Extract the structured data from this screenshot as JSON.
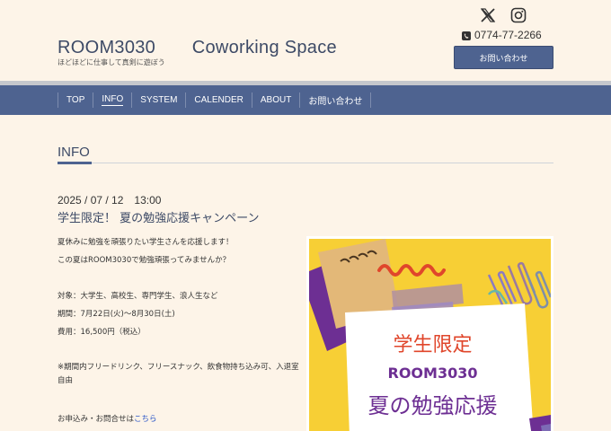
{
  "header": {
    "site_title": "ROOM3030　　Coworking Space",
    "tagline": "ほどほどに仕事して真剣に遊ぼう",
    "phone": "0774-77-2266",
    "contact_button": "お問い合わせ",
    "social_icons": [
      "x-icon",
      "instagram-icon"
    ]
  },
  "nav": {
    "items": [
      {
        "label": "TOP"
      },
      {
        "label": "INFO"
      },
      {
        "label": "SYSTEM"
      },
      {
        "label": "CALENDER"
      },
      {
        "label": "ABOUT"
      },
      {
        "label": "お問い合わせ"
      }
    ],
    "active": "INFO"
  },
  "section": {
    "title": "INFO"
  },
  "post": {
    "date": "2025 / 07 / 12　13:00",
    "title": "学生限定！ 夏の勉強応援キャンペーン",
    "lines": [
      "夏休みに勉強を頑張りたい学生さんを応援します！",
      "この夏はROOM3030で勉強頑張ってみませんか？",
      "対象：大学生、高校生、専門学生、浪人生など",
      "期間：7月22日(火)〜8月30日(土)",
      "費用：16,500円（税込）",
      "※期間内フリードリンク、フリースナック、飲食物持ち込み可、入退室自由"
    ],
    "apply_prefix": "お申込み・お問合せは",
    "apply_link": "こちら"
  },
  "poster": {
    "line1": "学生限定",
    "line2": "ROOM3030",
    "line3": "夏の勉強応援"
  },
  "colors": {
    "background": "#fdf4e8",
    "nav": "#4e6390",
    "title_text": "#3d4a66",
    "poster_yellow": "#f7cf35",
    "poster_red": "#e0462b",
    "poster_purple": "#6d2f93"
  }
}
